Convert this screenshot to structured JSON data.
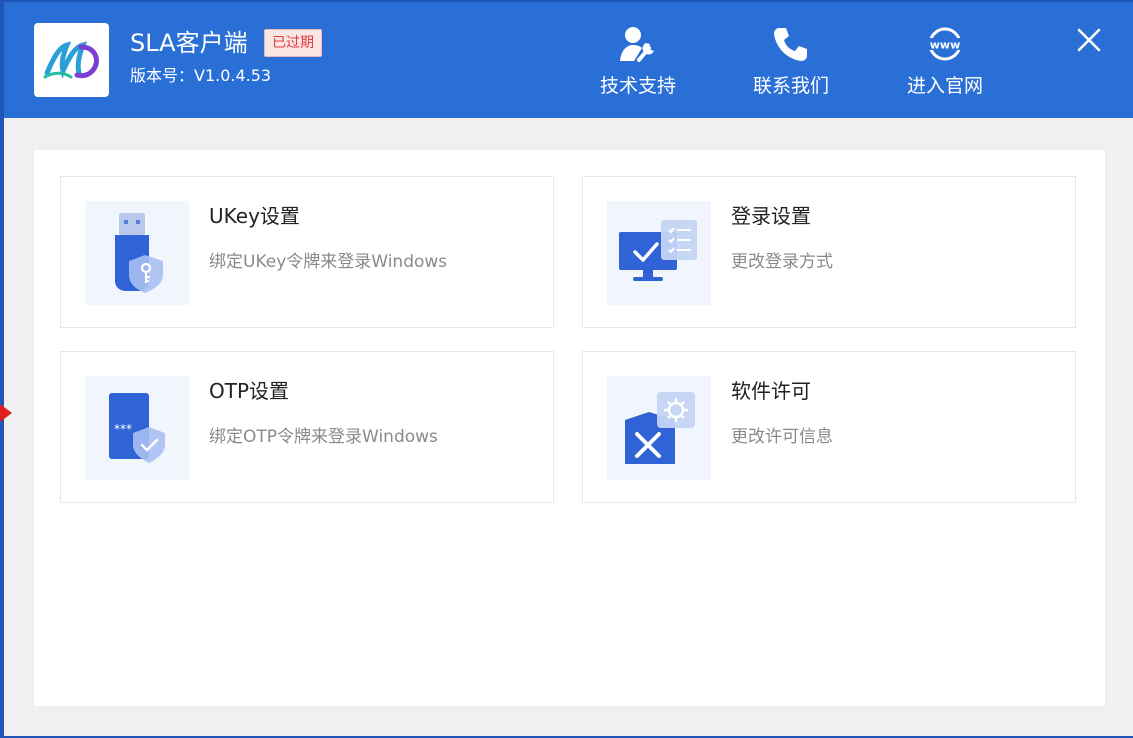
{
  "header": {
    "app_title": "SLA客户端",
    "expired_badge": "已过期",
    "version": "版本号：V1.0.4.53",
    "buttons": [
      {
        "label": "技术支持",
        "icon": "tech-support-icon"
      },
      {
        "label": "联系我们",
        "icon": "phone-icon"
      },
      {
        "label": "进入官网",
        "icon": "www-globe-icon"
      }
    ],
    "close_icon": "close-icon",
    "www_text": "www"
  },
  "cards": [
    {
      "title": "UKey设置",
      "desc": "绑定UKey令牌来登录Windows",
      "icon": "usb-key-shield-icon"
    },
    {
      "title": "登录设置",
      "desc": "更改登录方式",
      "icon": "monitor-checklist-icon"
    },
    {
      "title": "OTP设置",
      "desc": "绑定OTP令牌来登录Windows",
      "icon": "otp-token-shield-icon"
    },
    {
      "title": "软件许可",
      "desc": "更改许可信息",
      "icon": "license-toolbox-gear-icon"
    }
  ],
  "otp_mask": "***",
  "colors": {
    "header_bg": "#2a6fd6",
    "accent": "#2f63d6",
    "expired_badge_text": "#e23a3a",
    "window_bg": "#f0f0f0"
  }
}
